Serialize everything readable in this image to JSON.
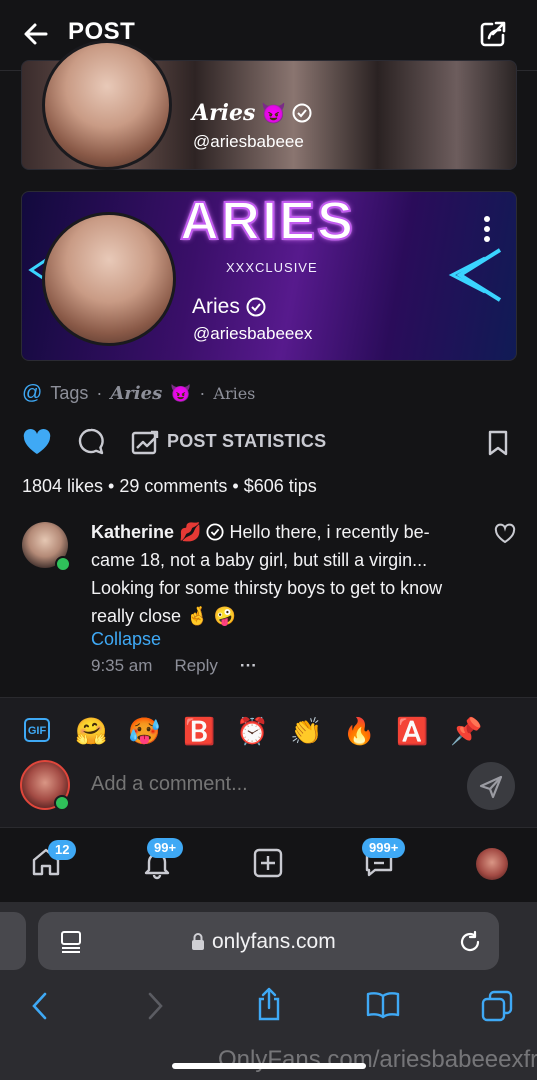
{
  "header": {
    "title": "POST"
  },
  "banner1": {
    "name": "Aries",
    "handle": "@ariesbabeee"
  },
  "banner2": {
    "logo": "ARIES",
    "subtitle": "XXXCLUSIVE",
    "name": "Aries",
    "handle": "@ariesbabeeex"
  },
  "tags": {
    "label": "Tags",
    "sep": "·",
    "tag1": "Aries",
    "tag2": "Aries"
  },
  "actions": {
    "stats_label": "POST STATISTICS"
  },
  "counts": {
    "text": "1804 likes • 29 comments • $606 tips"
  },
  "comment": {
    "author": "Katherine",
    "text": "Hello there, i recently be-came 18, not a baby girl, but still a virgin... Looking for some thirsty boys to get to know really close",
    "collapse": "Collapse",
    "time": "9:35 am",
    "reply": "Reply",
    "more": "···"
  },
  "emoji_bar": {
    "gif": "GIF",
    "emojis": [
      "🤗",
      "🥵",
      "🅱️",
      "⏰",
      "👏",
      "🔥",
      "🅰️",
      "📌"
    ]
  },
  "composer": {
    "placeholder": "Add a comment..."
  },
  "tabbar": {
    "home_badge": "12",
    "notif_badge": "99+",
    "msg_badge": "999+"
  },
  "browser": {
    "url": "onlyfans.com"
  },
  "watermark": "OnlyFans.com/ariesbabeeexfree",
  "colors": {
    "accent": "#3fa9f5",
    "like": "#3fa9f5",
    "online": "#2fc05a"
  }
}
